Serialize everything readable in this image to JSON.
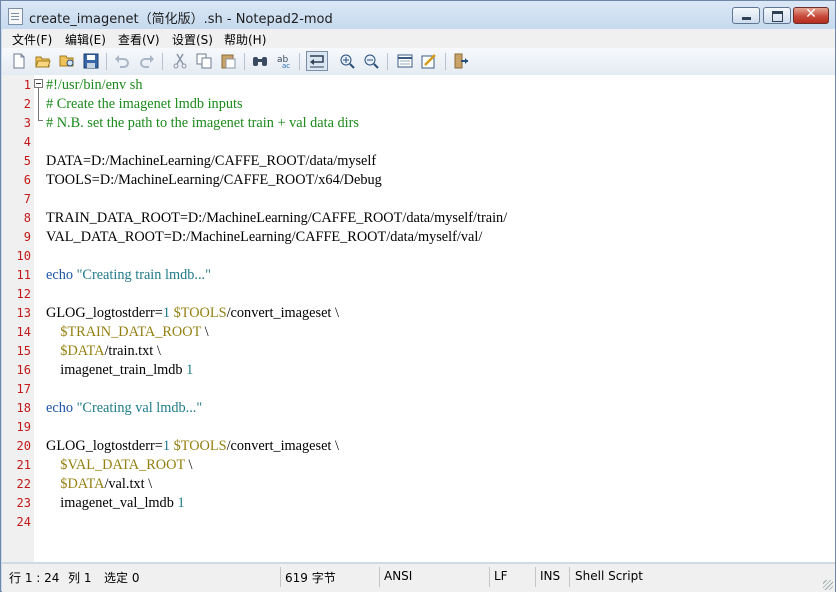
{
  "window": {
    "title": "create_imagenet（简化版）.sh - Notepad2-mod",
    "close_label": "✕"
  },
  "menu": [
    "文件(F)",
    "编辑(E)",
    "查看(V)",
    "设置(S)",
    "帮助(H)"
  ],
  "toolbar": {
    "icons": [
      "new-file-icon",
      "open-folder-icon",
      "browse-icon",
      "save-icon",
      "undo-icon",
      "redo-icon",
      "cut-icon",
      "copy-icon",
      "paste-icon",
      "find-icon",
      "replace-icon",
      "word-wrap-icon",
      "zoom-in-icon",
      "zoom-out-icon",
      "view-icon",
      "settings-icon",
      "exit-icon"
    ]
  },
  "editor": {
    "line_numbers": [
      "1",
      "2",
      "3",
      "4",
      "5",
      "6",
      "7",
      "8",
      "9",
      "10",
      "11",
      "12",
      "13",
      "14",
      "15",
      "16",
      "17",
      "18",
      "19",
      "20",
      "21",
      "22",
      "23",
      "24"
    ],
    "lines": [
      [
        {
          "t": "#!/usr/bin/env sh",
          "c": "comment"
        }
      ],
      [
        {
          "t": "# Create the imagenet lmdb inputs",
          "c": "comment"
        }
      ],
      [
        {
          "t": "# N.B. set the path to the imagenet train + val data dirs",
          "c": "comment"
        }
      ],
      [],
      [
        {
          "t": "DATA=D:/MachineLearning/CAFFE_ROOT/data/myself",
          "c": ""
        }
      ],
      [
        {
          "t": "TOOLS=D:/MachineLearning/CAFFE_ROOT/x64/Debug",
          "c": ""
        }
      ],
      [],
      [
        {
          "t": "TRAIN_DATA_ROOT=D:/MachineLearning/CAFFE_ROOT/data/myself/train/",
          "c": ""
        }
      ],
      [
        {
          "t": "VAL_DATA_ROOT=D:/MachineLearning/CAFFE_ROOT/data/myself/val/",
          "c": ""
        }
      ],
      [],
      [
        {
          "t": "echo",
          "c": "kw"
        },
        {
          "t": " ",
          "c": ""
        },
        {
          "t": "\"Creating train lmdb...\"",
          "c": "str"
        }
      ],
      [],
      [
        {
          "t": "GLOG_logtostderr=",
          "c": ""
        },
        {
          "t": "1",
          "c": "num"
        },
        {
          "t": " ",
          "c": ""
        },
        {
          "t": "$TOOLS",
          "c": "var"
        },
        {
          "t": "/convert_imageset \\",
          "c": ""
        }
      ],
      [
        {
          "t": "    ",
          "c": ""
        },
        {
          "t": "$TRAIN_DATA_ROOT",
          "c": "var"
        },
        {
          "t": " \\",
          "c": ""
        }
      ],
      [
        {
          "t": "    ",
          "c": ""
        },
        {
          "t": "$DATA",
          "c": "var"
        },
        {
          "t": "/train.txt \\",
          "c": ""
        }
      ],
      [
        {
          "t": "    imagenet_train_lmdb ",
          "c": ""
        },
        {
          "t": "1",
          "c": "num"
        }
      ],
      [],
      [
        {
          "t": "echo",
          "c": "kw"
        },
        {
          "t": " ",
          "c": ""
        },
        {
          "t": "\"Creating val lmdb...\"",
          "c": "str"
        }
      ],
      [],
      [
        {
          "t": "GLOG_logtostderr=",
          "c": ""
        },
        {
          "t": "1",
          "c": "num"
        },
        {
          "t": " ",
          "c": ""
        },
        {
          "t": "$TOOLS",
          "c": "var"
        },
        {
          "t": "/convert_imageset \\",
          "c": ""
        }
      ],
      [
        {
          "t": "    ",
          "c": ""
        },
        {
          "t": "$VAL_DATA_ROOT",
          "c": "var"
        },
        {
          "t": " \\",
          "c": ""
        }
      ],
      [
        {
          "t": "    ",
          "c": ""
        },
        {
          "t": "$DATA",
          "c": "var"
        },
        {
          "t": "/val.txt \\",
          "c": ""
        }
      ],
      [
        {
          "t": "    imagenet_val_lmdb ",
          "c": ""
        },
        {
          "t": "1",
          "c": "num"
        }
      ],
      []
    ]
  },
  "status": {
    "position": "行 1 : 24",
    "column": "列 1",
    "selection": "选定 0",
    "size": "619 字节",
    "encoding": "ANSI",
    "line_ending": "LF",
    "mode": "INS",
    "scheme": "Shell Script"
  },
  "colors": {
    "comment": "#1a8a1a",
    "keyword": "#1f55a8",
    "string": "#1f7a8a",
    "variable": "#948010",
    "line_number": "#c41818"
  }
}
